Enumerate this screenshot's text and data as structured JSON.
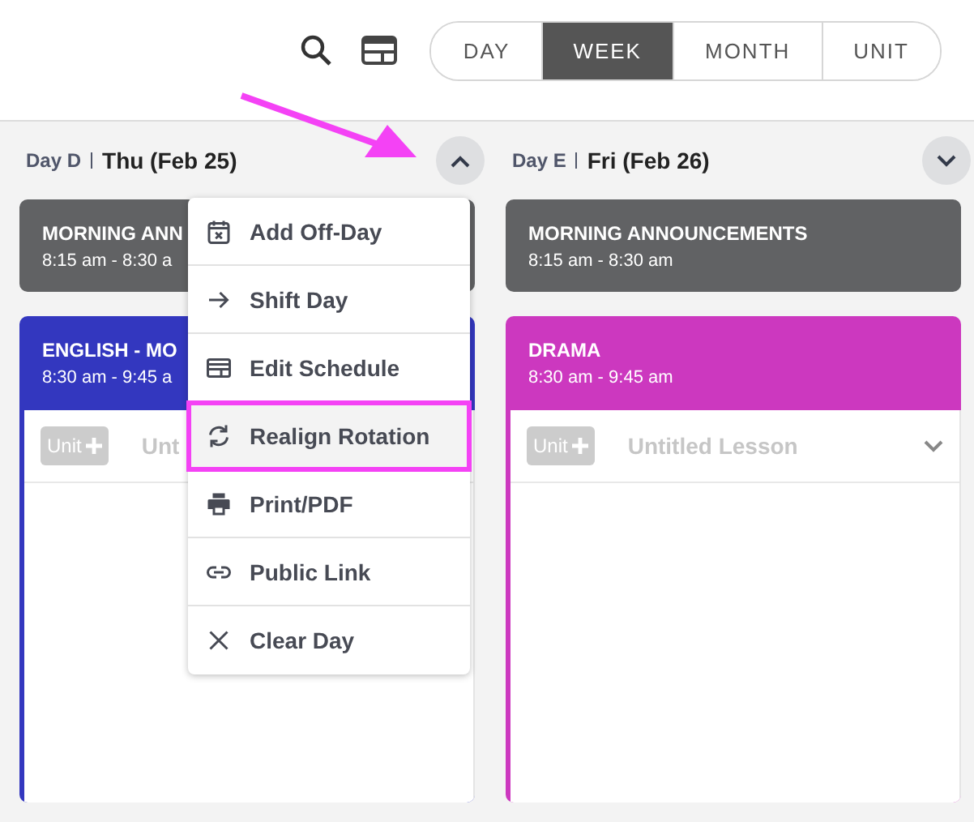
{
  "toolbar": {
    "views": [
      {
        "label": "DAY",
        "selected": false
      },
      {
        "label": "WEEK",
        "selected": true
      },
      {
        "label": "MONTH",
        "selected": false
      },
      {
        "label": "UNIT",
        "selected": false
      }
    ]
  },
  "days": [
    {
      "rotation": "Day D",
      "date": "Thu (Feb 25)",
      "expanded": true,
      "blocks": [
        {
          "kind": "event",
          "title": "MORNING ANN",
          "time": "8:15 am - 8:30 a",
          "color": "#616264"
        },
        {
          "kind": "class",
          "title": "ENGLISH - MO",
          "time": "8:30 am - 9:45 a",
          "color": "#3337bf",
          "lesson": {
            "unit": "Unit",
            "placeholder": "Unt"
          }
        }
      ]
    },
    {
      "rotation": "Day E",
      "date": "Fri (Feb 26)",
      "expanded": false,
      "blocks": [
        {
          "kind": "event",
          "title": "MORNING ANNOUNCEMENTS",
          "time": "8:15 am - 8:30 am",
          "color": "#616264"
        },
        {
          "kind": "class",
          "title": "DRAMA",
          "time": "8:30 am - 9:45 am",
          "color": "#cc38bf",
          "lesson": {
            "unit": "Unit",
            "placeholder": "Untitled Lesson"
          }
        }
      ]
    }
  ],
  "day_menu": {
    "items": [
      {
        "label": "Add Off-Day",
        "selected": false
      },
      {
        "label": "Shift Day",
        "selected": false
      },
      {
        "label": "Edit Schedule",
        "selected": false
      },
      {
        "label": "Realign Rotation",
        "selected": true
      },
      {
        "label": "Print/PDF",
        "selected": false
      },
      {
        "label": "Public Link",
        "selected": false
      },
      {
        "label": "Clear Day",
        "selected": false
      }
    ]
  }
}
